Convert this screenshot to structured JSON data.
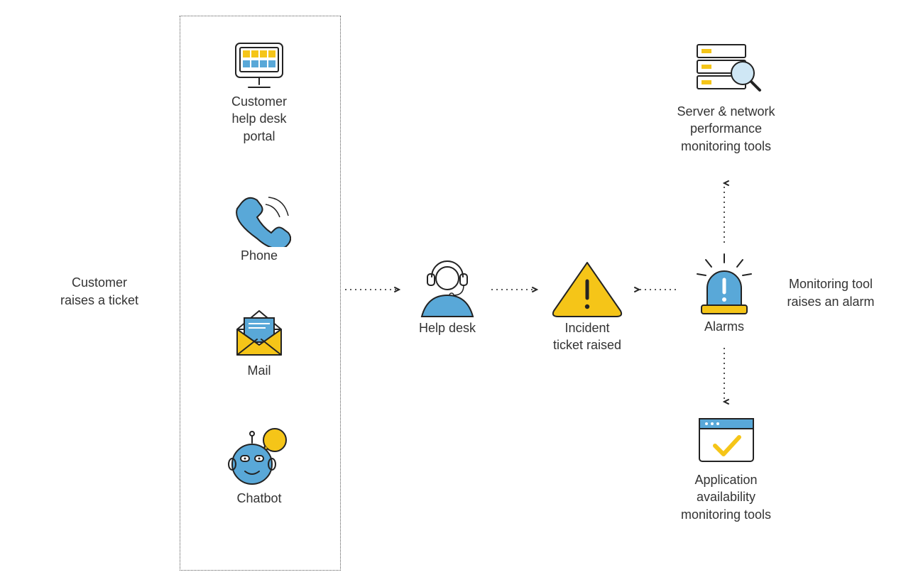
{
  "left_caption": "Customer\nraises a ticket",
  "right_caption": "Monitoring tool\nraises an alarm",
  "channels": {
    "portal": "Customer\nhelp desk\nportal",
    "phone": "Phone",
    "mail": "Mail",
    "chatbot": "Chatbot"
  },
  "center": {
    "helpdesk": "Help desk",
    "incident": "Incident\nticket raised",
    "alarms": "Alarms"
  },
  "monitoring": {
    "server": "Server & network\nperformance\nmonitoring tools",
    "app": "Application\navailability\nmonitoring tools"
  },
  "colors": {
    "yellow": "#F5C518",
    "blue": "#59A8D8",
    "ink": "#232323"
  }
}
